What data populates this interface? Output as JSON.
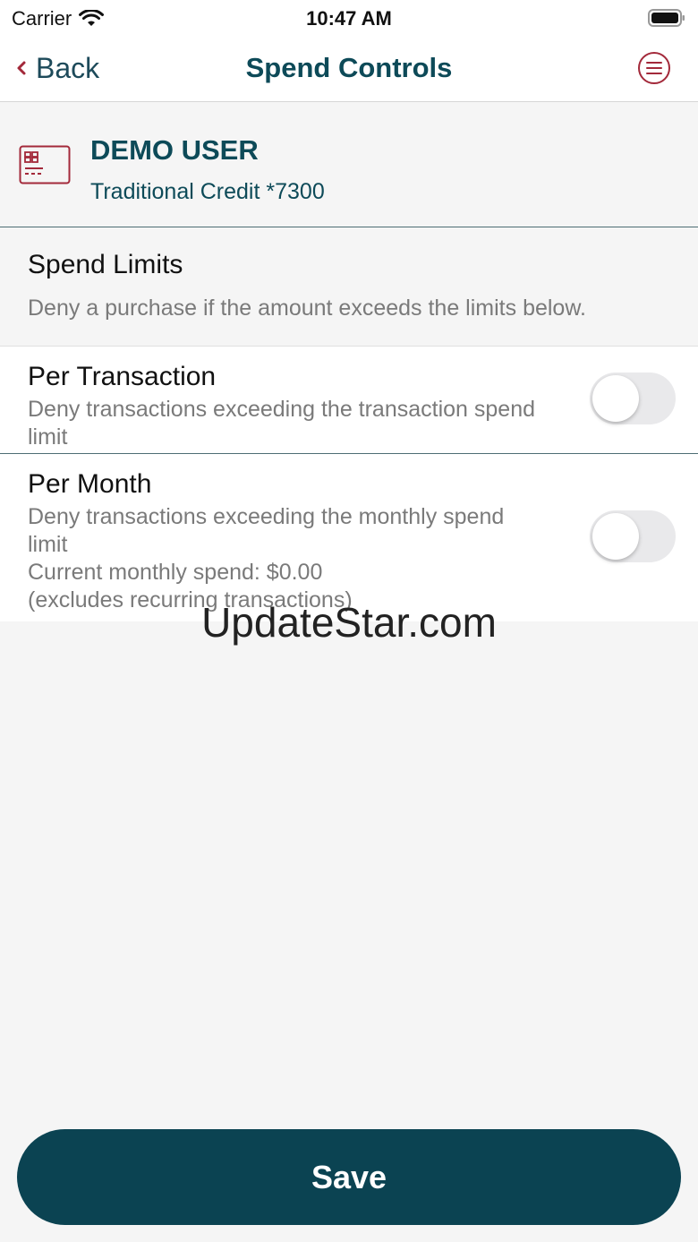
{
  "status_bar": {
    "carrier": "Carrier",
    "time": "10:47 AM",
    "icons": [
      "wifi-icon",
      "battery-icon"
    ]
  },
  "nav": {
    "back_label": "Back",
    "title": "Spend Controls",
    "icons": [
      "chevron-left-icon",
      "menu-icon"
    ]
  },
  "account": {
    "name": "DEMO USER",
    "card": "Traditional Credit *7300",
    "icon": "credit-card-icon"
  },
  "section": {
    "title": "Spend Limits",
    "description": "Deny a purchase if the amount exceeds the limits below."
  },
  "rows": [
    {
      "title": "Per Transaction",
      "description": "Deny transactions exceeding the transaction spend limit",
      "enabled": false
    },
    {
      "title": "Per Month",
      "description": "Deny transactions exceeding the monthly spend limit",
      "current_spend": "Current monthly spend: $0.00",
      "note": "(excludes recurring transactions)",
      "enabled": false
    }
  ],
  "watermark": "UpdateStar.com",
  "save_label": "Save",
  "colors": {
    "brand": "#0b4352",
    "accent": "#a3293a",
    "background": "#f5f5f5"
  }
}
